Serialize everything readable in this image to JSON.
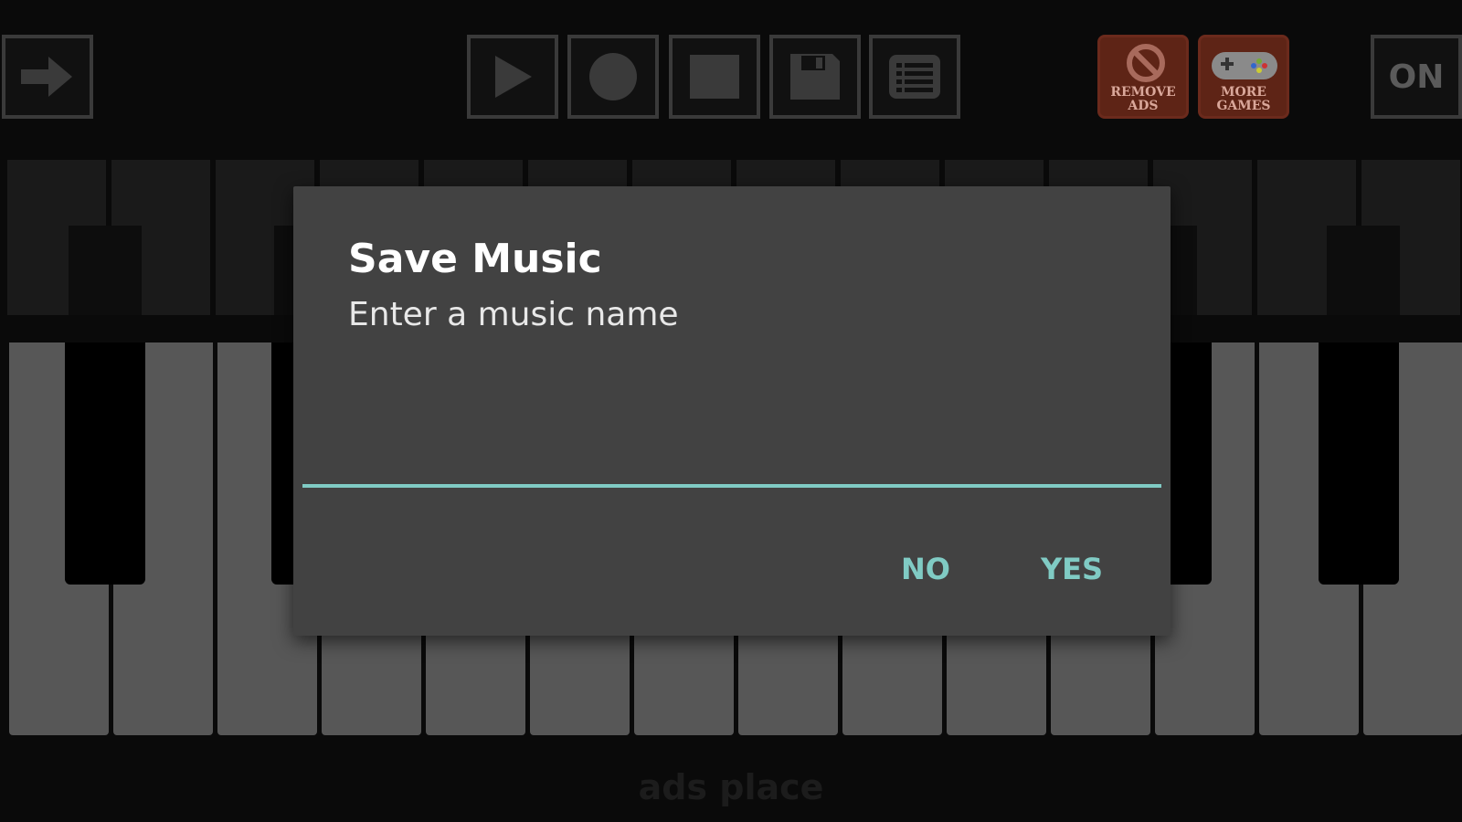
{
  "toolbar": {
    "back_icon": "arrow-right-icon",
    "play_icon": "play-icon",
    "record_icon": "record-icon",
    "stop_icon": "stop-icon",
    "save_icon": "floppy-save-icon",
    "list_icon": "list-icon",
    "remove_ads_label": "REMOVE\nADS",
    "more_games_label": "MORE\nGAMES",
    "power_label": "ON"
  },
  "piano": {
    "white_key_color": "#575757",
    "black_key_color": "#000000"
  },
  "footer": {
    "ads_text": "ads place"
  },
  "dialog": {
    "title": "Save Music",
    "message": "Enter a music name",
    "input_value": "",
    "no_label": "NO",
    "yes_label": "YES",
    "accent_color": "#80cbc4"
  }
}
